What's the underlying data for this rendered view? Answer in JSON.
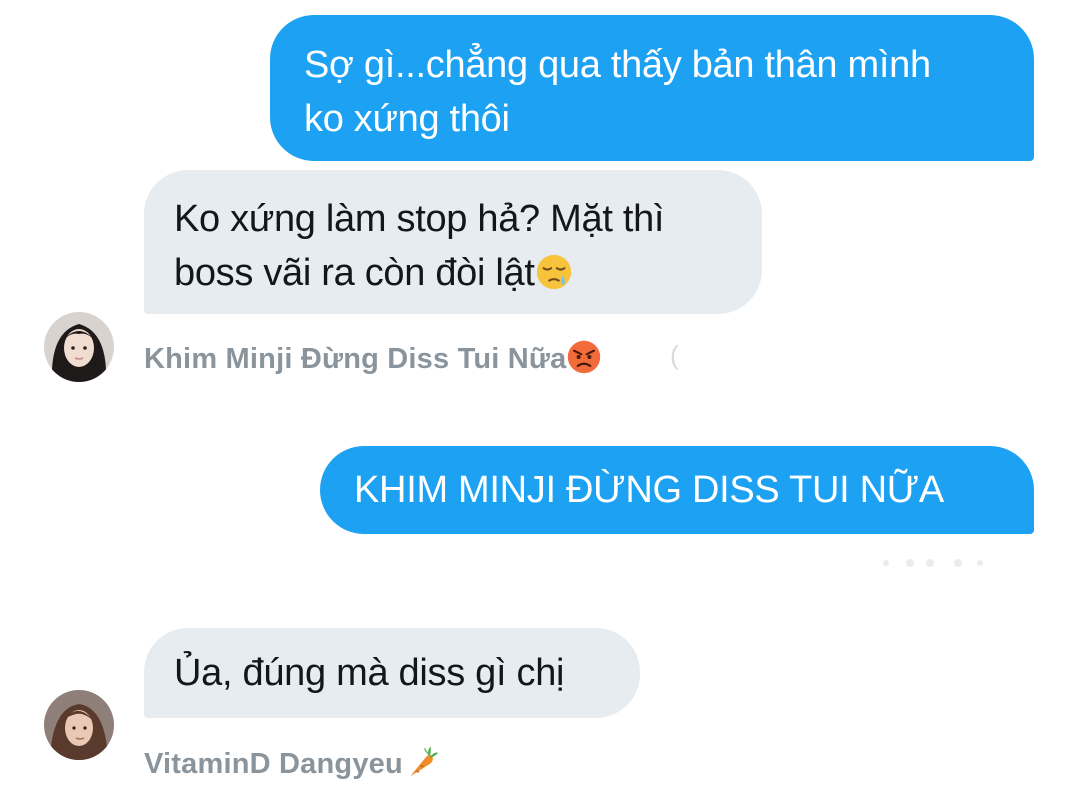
{
  "messages": [
    {
      "direction": "outgoing",
      "lines": [
        "Sợ gì...chẳng qua thấy bản thân mình",
        "ko xứng thôi"
      ]
    },
    {
      "direction": "incoming",
      "lines": [
        "Ko xứng làm stop hả? Mặt thì",
        "boss vãi ra còn đòi lật"
      ],
      "trailing_icon": "sleepy-face-emoji"
    },
    {
      "direction": "outgoing",
      "lines": [
        "KHIM MINJI ĐỪNG DISS TUI NỮA"
      ]
    },
    {
      "direction": "incoming",
      "lines": [
        "Ủa, đúng mà diss gì chị"
      ]
    }
  ],
  "senders": [
    {
      "name": "Khim Minji Đừng Diss Tui Nữa",
      "icon": "angry-face-emoji"
    },
    {
      "name": "VitaminD Dangyeu",
      "icon": "carrot-emoji"
    }
  ],
  "colors": {
    "outgoing_bubble": "#1da1f2",
    "incoming_bubble": "#e6ecf0",
    "sender_text": "#8a949c"
  }
}
